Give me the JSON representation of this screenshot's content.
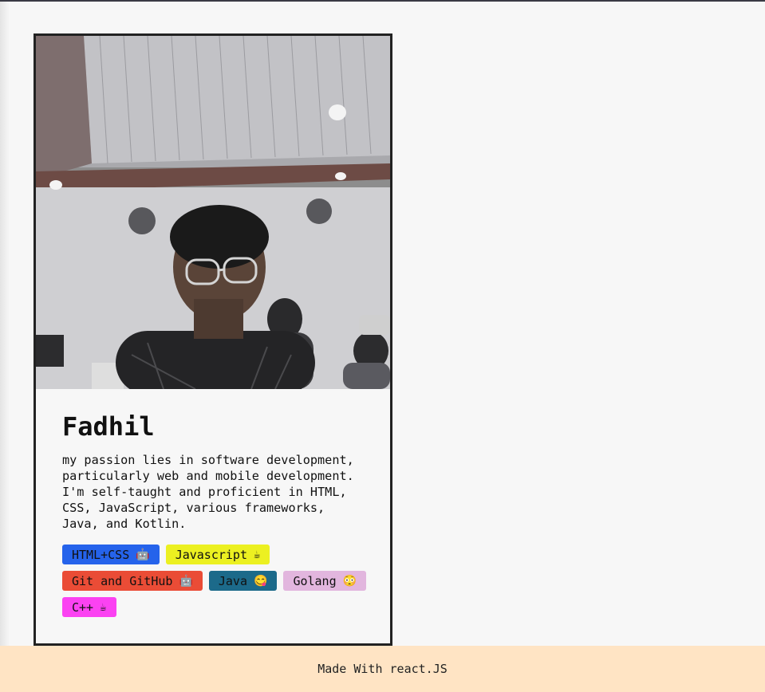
{
  "profile": {
    "name": "Fadhil",
    "bio": "my passion lies in software development, particularly web and mobile development. I'm self-taught and proficient in HTML, CSS, JavaScript, various frameworks, Java, and Kotlin."
  },
  "skills": [
    {
      "label": "HTML+CSS",
      "emoji": "🤖",
      "color": "#2563eb"
    },
    {
      "label": "Javascript",
      "emoji": "☕",
      "color": "#ecf021"
    },
    {
      "label": "Git and GitHub",
      "emoji": "🤖",
      "color": "#ea4c36"
    },
    {
      "label": "Java",
      "emoji": "😋",
      "color": "#1c6a8a"
    },
    {
      "label": "Golang",
      "emoji": "😳",
      "color": "#e2b6de"
    },
    {
      "label": "C++",
      "emoji": "☕",
      "color": "#fb42f2"
    }
  ],
  "footer": {
    "text": "Made With react.JS"
  }
}
